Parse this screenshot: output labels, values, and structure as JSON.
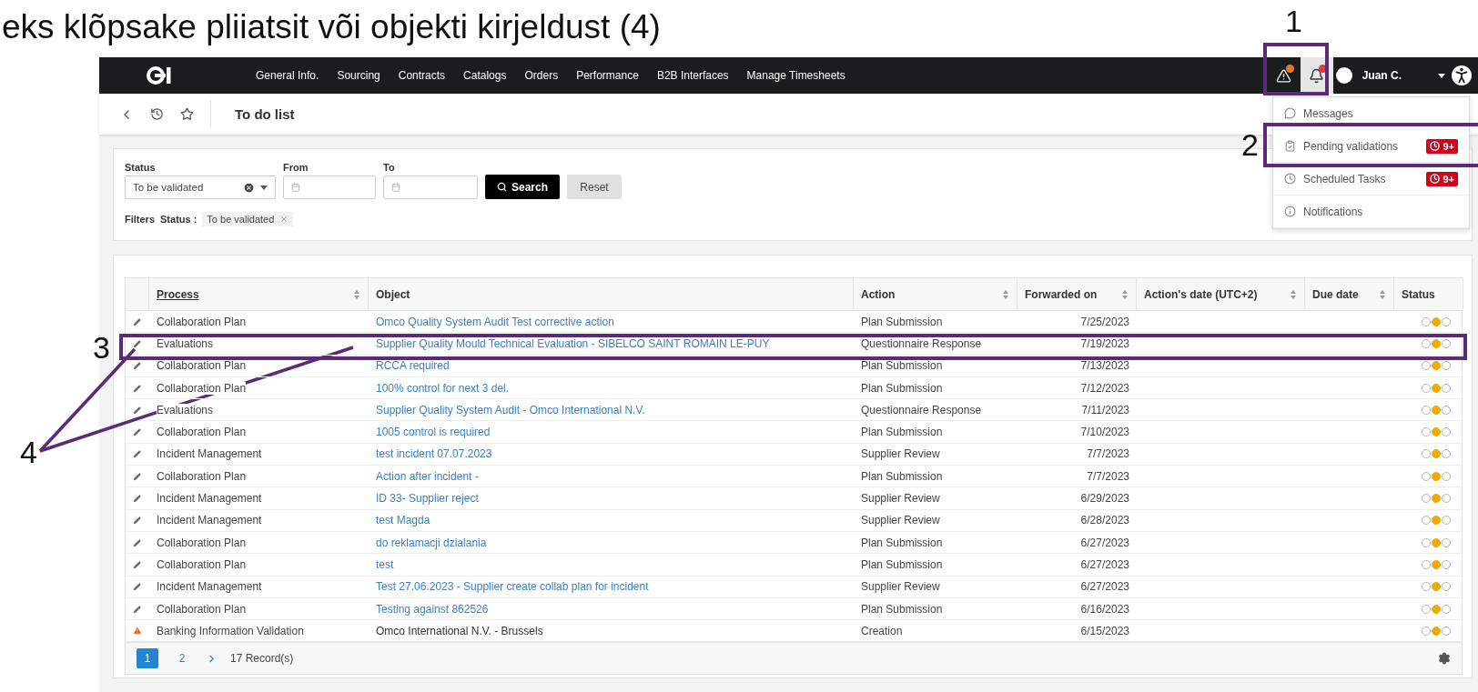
{
  "annotation": {
    "caption": "eks klõpsake pliiatsit või objekti kirjeldust (4)",
    "markers": [
      "1",
      "2",
      "3",
      "4"
    ]
  },
  "navbar": {
    "menu": [
      "General Info.",
      "Sourcing",
      "Contracts",
      "Catalogs",
      "Orders",
      "Performance",
      "B2B Interfaces",
      "Manage Timesheets"
    ],
    "warning": {
      "dot": true
    },
    "bell": {
      "dot": true,
      "selected": true
    },
    "user": "Juan C."
  },
  "dropdown": [
    {
      "kind": "messages",
      "label": "Messages"
    },
    {
      "kind": "validations",
      "label": "Pending validations",
      "badge": "9+"
    },
    {
      "kind": "tasks",
      "label": "Scheduled Tasks",
      "badge": "9+"
    },
    {
      "kind": "info",
      "label": "Notifications"
    }
  ],
  "page": {
    "title": "To do list"
  },
  "filters": {
    "status": {
      "label": "Status",
      "value": "To be validated"
    },
    "from": {
      "label": "From"
    },
    "to": {
      "label": "To"
    },
    "search": "Search",
    "reset": "Reset",
    "applied_label": "Filters",
    "chips": [
      {
        "field": "Status :",
        "value": "To be validated"
      }
    ]
  },
  "table": {
    "columns": [
      {
        "label": "Process",
        "sortable": true,
        "sorted": true
      },
      {
        "label": "Object",
        "sortable": false,
        "sorted": false
      },
      {
        "label": "Action",
        "sortable": true,
        "sorted": false
      },
      {
        "label": "Forwarded on",
        "sortable": true,
        "sorted": false
      },
      {
        "label": "Action's date (UTC+2)",
        "sortable": true,
        "sorted": false
      },
      {
        "label": "Due date",
        "sortable": true,
        "sorted": false
      },
      {
        "label": "Status",
        "sortable": false,
        "sorted": false
      }
    ],
    "rows": [
      {
        "kind": "edit",
        "process": "Collaboration Plan",
        "object": "Omco Quality System Audit Test corrective action",
        "action": "Plan Submission",
        "forwarded": "7/25/2023",
        "status_dots": [
          false,
          true,
          false
        ]
      },
      {
        "kind": "edit",
        "process": "Evaluations",
        "object": "Supplier Quality Mould Technical Evaluation - SIBELCO SAINT ROMAIN LE-PUY",
        "action": "Questionnaire Response",
        "forwarded": "7/19/2023",
        "status_dots": [
          false,
          true,
          false
        ]
      },
      {
        "kind": "edit",
        "process": "Collaboration Plan",
        "object": "RCCA required",
        "action": "Plan Submission",
        "forwarded": "7/13/2023",
        "status_dots": [
          false,
          true,
          false
        ]
      },
      {
        "kind": "edit",
        "process": "Collaboration Plan",
        "object": "100% control for next 3 del.",
        "action": "Plan Submission",
        "forwarded": "7/12/2023",
        "status_dots": [
          false,
          true,
          false
        ]
      },
      {
        "kind": "edit",
        "process": "Evaluations",
        "object": "Supplier Quality System Audit - Omco International N.V.",
        "action": "Questionnaire Response",
        "forwarded": "7/11/2023",
        "status_dots": [
          false,
          true,
          false
        ]
      },
      {
        "kind": "edit",
        "process": "Collaboration Plan",
        "object": "1005 control is required",
        "action": "Plan Submission",
        "forwarded": "7/10/2023",
        "status_dots": [
          false,
          true,
          false
        ]
      },
      {
        "kind": "edit",
        "process": "Incident Management",
        "object": "test incident 07.07.2023",
        "action": "Supplier Review",
        "forwarded": "7/7/2023",
        "status_dots": [
          false,
          true,
          false
        ]
      },
      {
        "kind": "edit",
        "process": "Collaboration Plan",
        "object": "Action after incident -",
        "action": "Plan Submission",
        "forwarded": "7/7/2023",
        "status_dots": [
          false,
          true,
          false
        ]
      },
      {
        "kind": "edit",
        "process": "Incident Management",
        "object": "ID 33- Supplier reject",
        "action": "Supplier Review",
        "forwarded": "6/29/2023",
        "status_dots": [
          false,
          true,
          false
        ]
      },
      {
        "kind": "edit",
        "process": "Incident Management",
        "object": "test Magda",
        "action": "Supplier Review",
        "forwarded": "6/28/2023",
        "status_dots": [
          false,
          true,
          false
        ]
      },
      {
        "kind": "edit",
        "process": "Collaboration Plan",
        "object": "do reklamacji dzialania",
        "action": "Plan Submission",
        "forwarded": "6/27/2023",
        "status_dots": [
          false,
          true,
          false
        ]
      },
      {
        "kind": "edit",
        "process": "Collaboration Plan",
        "object": "test",
        "action": "Plan Submission",
        "forwarded": "6/27/2023",
        "status_dots": [
          false,
          true,
          false
        ]
      },
      {
        "kind": "edit",
        "process": "Incident Management",
        "object": "Test 27.06.2023 - Supplier create collab plan for incident",
        "action": "Supplier Review",
        "forwarded": "6/27/2023",
        "status_dots": [
          false,
          true,
          false
        ]
      },
      {
        "kind": "edit",
        "process": "Collaboration Plan",
        "object": "Testing against 862526",
        "action": "Plan Submission",
        "forwarded": "6/16/2023",
        "status_dots": [
          false,
          true,
          false
        ]
      },
      {
        "kind": "alert",
        "process": "Banking Information Validation",
        "object": "Omco International N.V. - Brussels",
        "action": "Creation",
        "forwarded": "6/15/2023",
        "status_dots": [
          false,
          true,
          false
        ]
      }
    ]
  },
  "pagination": {
    "pages": [
      {
        "label": "1",
        "selected": true
      },
      {
        "label": "2",
        "selected": false
      }
    ],
    "records": "17 Record(s)"
  }
}
